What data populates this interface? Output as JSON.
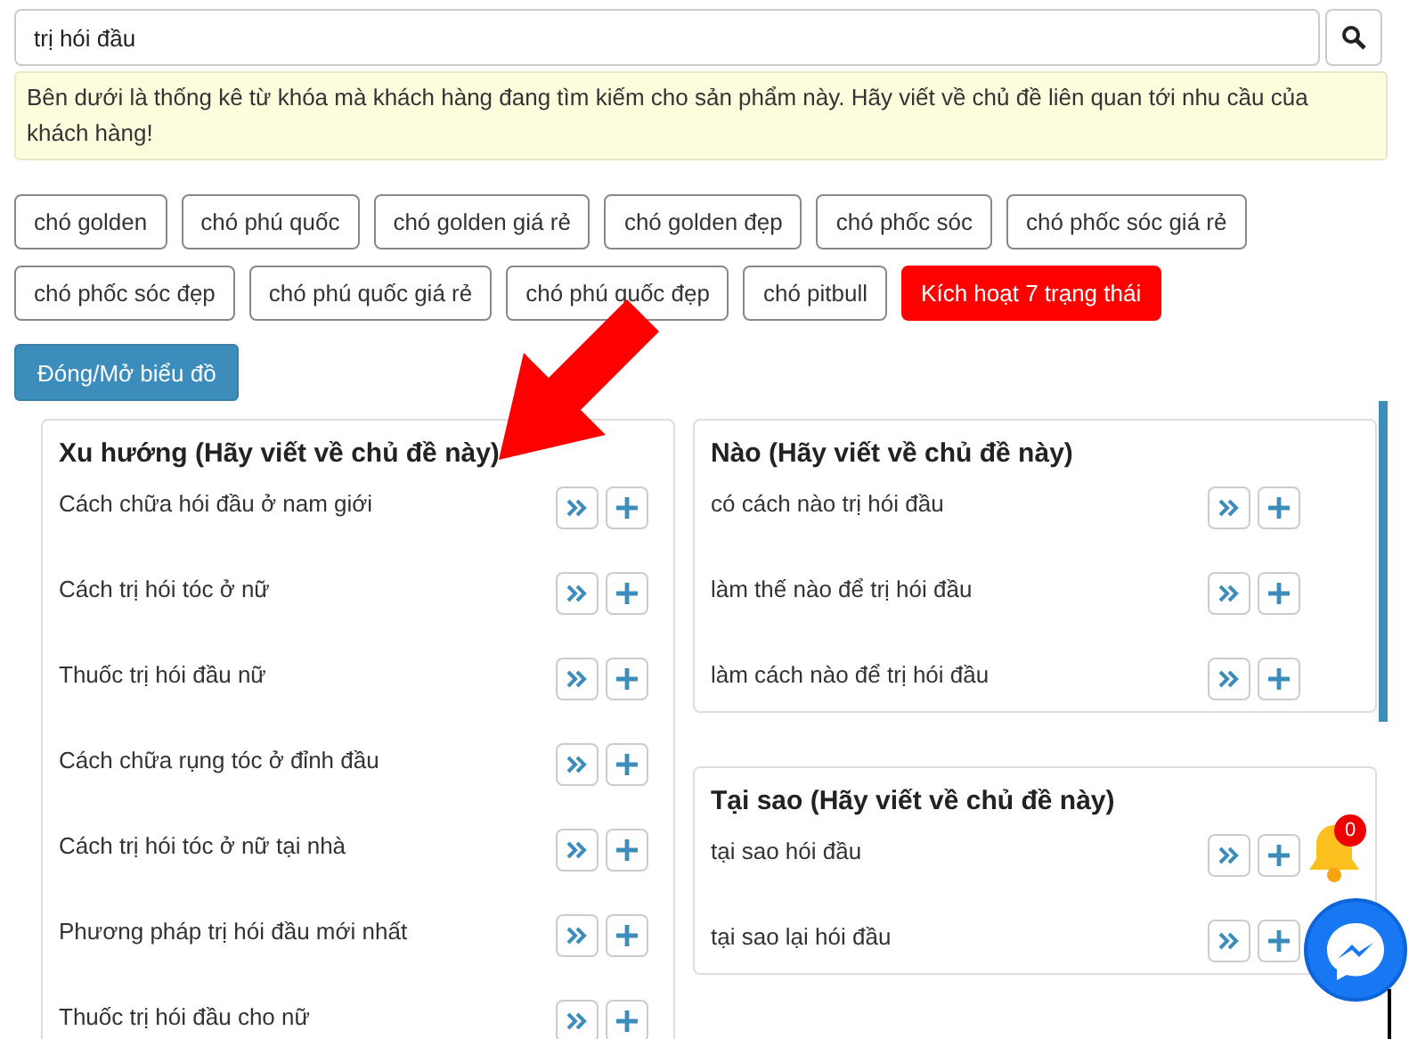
{
  "search": {
    "value": "trị hói đầu"
  },
  "hint": "Bên dưới là thống kê từ khóa mà khách hàng đang tìm kiếm cho sản phẩm này. Hãy viết về chủ đề liên quan tới nhu cầu của khách hàng!",
  "tags": [
    {
      "label": "chó golden",
      "kind": "keyword"
    },
    {
      "label": "chó phú quốc",
      "kind": "keyword"
    },
    {
      "label": "chó golden giá rẻ",
      "kind": "keyword"
    },
    {
      "label": "chó golden đẹp",
      "kind": "keyword"
    },
    {
      "label": "chó phốc sóc",
      "kind": "keyword"
    },
    {
      "label": "chó phốc sóc giá rẻ",
      "kind": "keyword"
    },
    {
      "label": "chó phốc sóc đẹp",
      "kind": "keyword"
    },
    {
      "label": "chó phú quốc giá rẻ",
      "kind": "keyword"
    },
    {
      "label": "chó phú quốc đẹp",
      "kind": "keyword"
    },
    {
      "label": "chó pitbull",
      "kind": "keyword"
    },
    {
      "label": "Kích hoạt 7 trạng thái",
      "kind": "action"
    }
  ],
  "chart_toggle": "Đóng/Mở biểu đồ",
  "panels": [
    {
      "title": "Xu hướng (Hãy viết về chủ đề này)",
      "items": [
        "Cách chữa hói đầu ở nam giới",
        "Cách trị hói tóc ở nữ",
        "Thuốc trị hói đầu nữ",
        "Cách chữa rụng tóc ở đỉnh đầu",
        "Cách trị hói tóc ở nữ tại nhà",
        "Phương pháp trị hói đầu mới nhất",
        "Thuốc trị hói đầu cho nữ"
      ]
    },
    {
      "title": "Nào (Hãy viết về chủ đề này)",
      "items": [
        "có cách nào trị hói đầu",
        "làm thế nào để trị hói đầu",
        "làm cách nào để trị hói đầu"
      ]
    },
    {
      "title": "Tại sao (Hãy viết về chủ đề này)",
      "items": [
        "tại sao hói đầu",
        "tại sao lại hói đầu"
      ]
    }
  ],
  "notification_count": "0"
}
